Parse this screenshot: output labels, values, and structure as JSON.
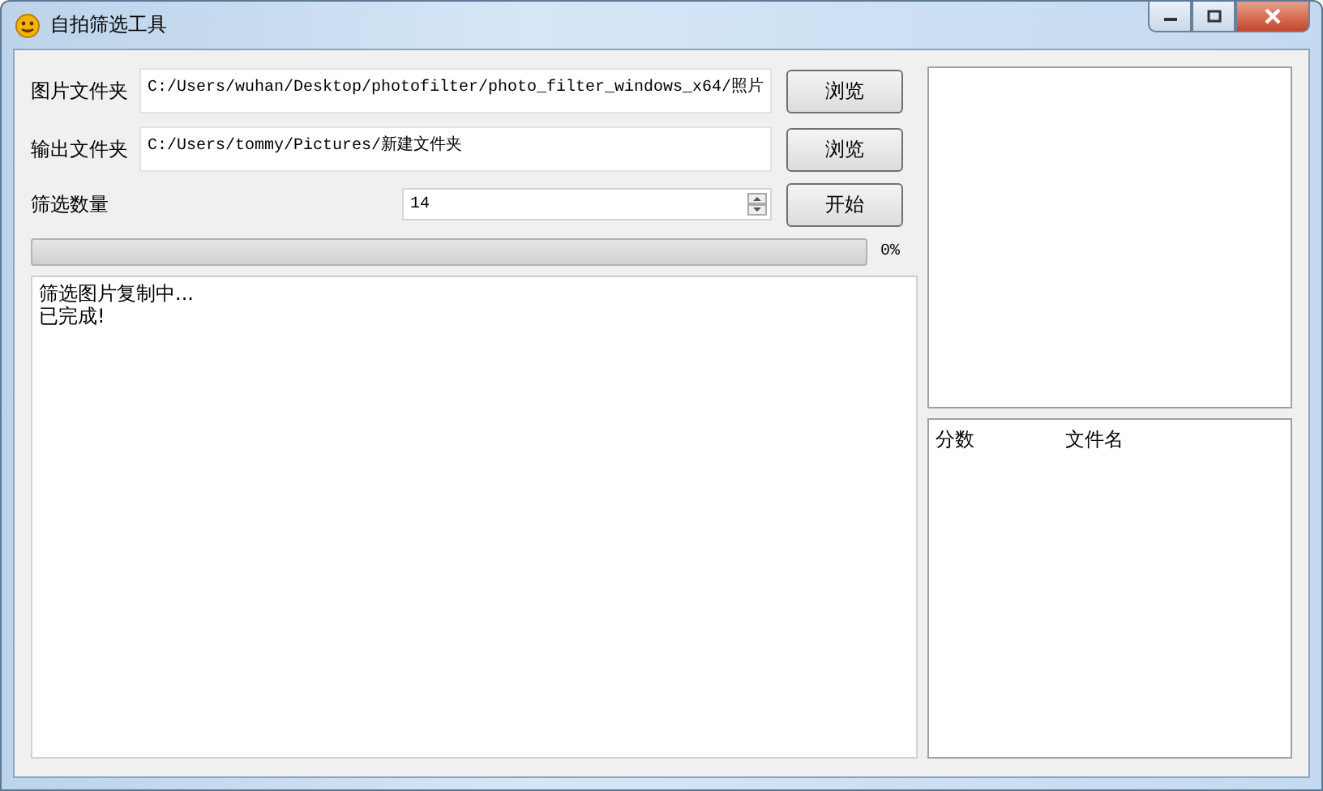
{
  "window": {
    "title": "自拍筛选工具"
  },
  "inputs": [
    {
      "label": "图片文件夹",
      "value": "C:/Users/wuhan/Desktop/photofilter/photo_filter_windows_x64/照片",
      "button": "浏览"
    },
    {
      "label": "输出文件夹",
      "value": "C:/Users/tommy/Pictures/新建文件夹",
      "button": "浏览"
    }
  ],
  "count": {
    "label": "筛选数量",
    "value": "14",
    "button": "开始"
  },
  "progress": {
    "level": 0,
    "reading": "0%"
  },
  "log": [
    "筛选图片复制中...",
    "已完成!"
  ],
  "results": {
    "columns": [
      "分数",
      "文件名"
    ]
  }
}
